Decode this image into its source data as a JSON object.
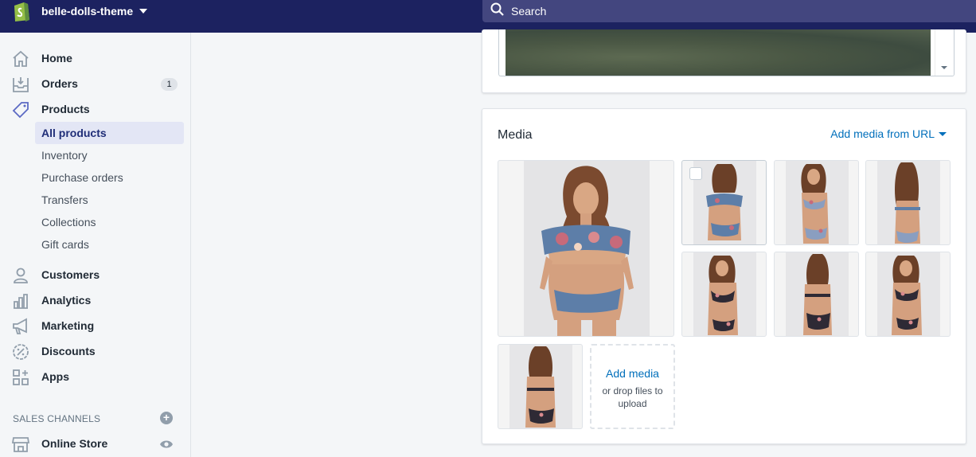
{
  "topbar": {
    "store_name": "belle-dolls-theme",
    "search_placeholder": "Search",
    "brand_color": "#1c2260"
  },
  "sidebar": {
    "items": [
      {
        "label": "Home",
        "icon": "home-icon"
      },
      {
        "label": "Orders",
        "icon": "orders-icon",
        "badge": "1"
      },
      {
        "label": "Products",
        "icon": "tag-icon"
      }
    ],
    "product_subitems": [
      "All products",
      "Inventory",
      "Purchase orders",
      "Transfers",
      "Collections",
      "Gift cards"
    ],
    "active_subitem": "All products",
    "items_after": [
      {
        "label": "Customers",
        "icon": "customers-icon"
      },
      {
        "label": "Analytics",
        "icon": "analytics-icon"
      },
      {
        "label": "Marketing",
        "icon": "megaphone-icon"
      },
      {
        "label": "Discounts",
        "icon": "discount-icon"
      },
      {
        "label": "Apps",
        "icon": "apps-icon"
      }
    ],
    "channels_title": "SALES CHANNELS",
    "channel_item": {
      "label": "Online Store",
      "icon": "store-icon"
    }
  },
  "media": {
    "title": "Media",
    "add_from_url": "Add media from URL",
    "add_media": "Add media",
    "drop_hint": "or drop files to upload",
    "image_count": 8,
    "link_color": "#006fbb"
  }
}
